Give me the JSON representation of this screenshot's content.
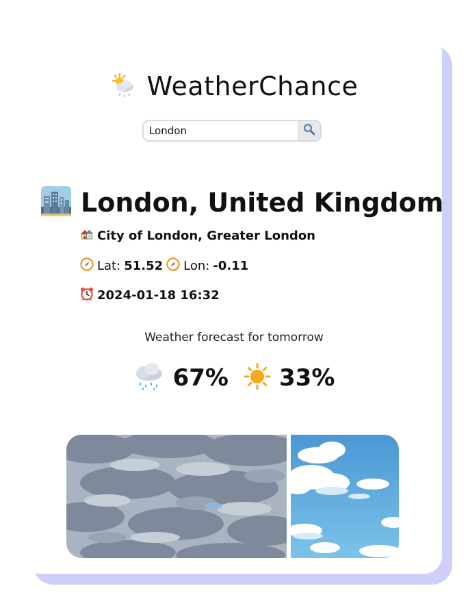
{
  "app": {
    "title": "WeatherChance",
    "logo_icon": "sun-behind-rain-cloud-icon"
  },
  "search": {
    "value": "London",
    "button_icon": "magnifier-icon"
  },
  "location": {
    "icon": "cityscape-icon",
    "name": "London, United Kingdom",
    "region_icon": "houses-icon",
    "region": "City of London, Greater London",
    "lat_label": "Lat:",
    "lat": "51.52",
    "lon_label": "Lon:",
    "lon": "-0.11",
    "coord_icon": "compass-icon",
    "time_icon": "alarm-clock-icon",
    "datetime": "2024-01-18 16:32"
  },
  "forecast": {
    "label": "Weather forecast for tomorrow",
    "rain": {
      "icon": "rain-cloud-icon",
      "percent_text": "67%",
      "value": 67
    },
    "sun": {
      "icon": "sun-icon",
      "percent_text": "33%",
      "value": 33
    }
  },
  "gallery": {
    "rain_image": "rainy-sky-image",
    "sun_image": "sunny-sky-image"
  },
  "colors": {
    "card_shadow": "#cfcffb",
    "text": "#111111",
    "search_border": "#d9d9d9",
    "sun": "#f7a91e",
    "rain": "#3b9ee0"
  }
}
